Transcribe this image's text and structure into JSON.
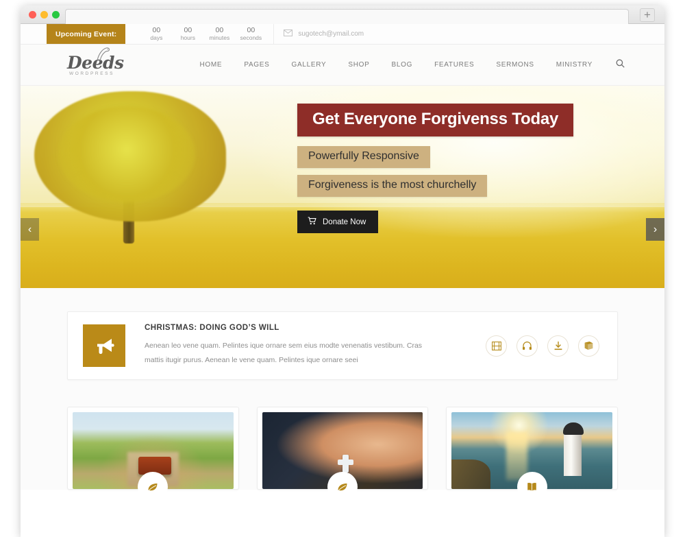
{
  "browser": {
    "new_tab_label": "+",
    "traffic_lights": [
      "close",
      "minimize",
      "maximize"
    ]
  },
  "topbar": {
    "upcoming_label": "Upcoming Event:",
    "countdown": [
      {
        "value": "00",
        "unit": "days"
      },
      {
        "value": "00",
        "unit": "hours"
      },
      {
        "value": "00",
        "unit": "minutes"
      },
      {
        "value": "00",
        "unit": "seconds"
      }
    ],
    "email": "sugotech@ymail.com",
    "email_icon": "envelope-icon"
  },
  "header": {
    "logo_word": "Deeds",
    "logo_sub": "WORDPRESS",
    "logo_icon": "dove-icon",
    "nav": [
      {
        "label": "HOME"
      },
      {
        "label": "PAGES"
      },
      {
        "label": "GALLERY"
      },
      {
        "label": "SHOP"
      },
      {
        "label": "BLOG"
      },
      {
        "label": "FEATURES"
      },
      {
        "label": "SERMONS"
      },
      {
        "label": "MINISTRY"
      }
    ],
    "search_icon": "search-icon"
  },
  "hero": {
    "title": "Get Everyone Forgivenss Today",
    "subtitle_1": "Powerfully Responsive",
    "subtitle_2": "Forgiveness is the most churchelly",
    "cta_label": "Donate Now",
    "cta_icon": "cart-icon",
    "prev_arrow": "‹",
    "next_arrow": "›",
    "title_bg": "#8e2d28",
    "subtitle_bg": "#cdb180",
    "cta_bg": "#1d1d1d",
    "image_description": "Golden autumn tree in a yellow wheat field"
  },
  "sermon": {
    "icon": "megaphone-icon",
    "title": "CHRISTMAS: DOING GOD’S WILL",
    "text": "Aenean leo vene quam. Pelintes ique ornare sem eius modte venenatis vestibum. Cras mattis itugir purus. Aenean le vene quam. Pelintes ique ornare seei",
    "accent_color": "#ba8a18",
    "actions": [
      {
        "icon": "film-icon",
        "name": "video"
      },
      {
        "icon": "headphones-icon",
        "name": "audio"
      },
      {
        "icon": "download-icon",
        "name": "download"
      },
      {
        "icon": "book-icon",
        "name": "notes"
      }
    ]
  },
  "cards": [
    {
      "image": "dirt-road-with-suitcase",
      "badge_icon": "leaf-icon"
    },
    {
      "image": "praying-hands-with-rosary",
      "badge_icon": "leaf-icon"
    },
    {
      "image": "lighthouse-at-sunset",
      "badge_icon": "book-icon"
    }
  ]
}
